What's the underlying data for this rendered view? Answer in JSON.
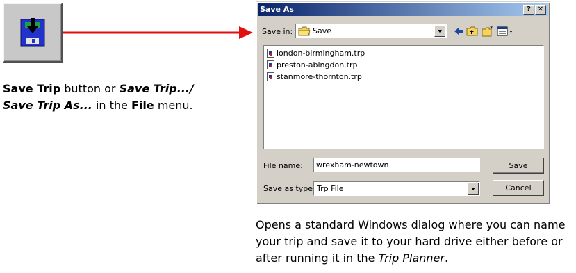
{
  "left_caption": {
    "bold1": "Save Trip",
    "text1": " button or ",
    "bi1": "Save Trip.../",
    "bi2": "Save Trip As...",
    "text2": " in the ",
    "bold2": "File",
    "text3": " menu."
  },
  "dialog": {
    "title": "Save As",
    "help_label": "?",
    "close_label": "✕",
    "save_in_label": "Save in:",
    "save_in_value": "Save",
    "files": [
      "london-birmingham.trp",
      "preston-abingdon.trp",
      "stanmore-thornton.trp"
    ],
    "file_name_label": "File name:",
    "file_name_value": "wrexham-newtown",
    "save_type_label": "Save as type:",
    "save_type_value": "Trp File",
    "save_button": "Save",
    "cancel_button": "Cancel"
  },
  "right_caption": {
    "text1": "Opens a standard Windows dialog where you can name your trip and save it to your hard drive either before or after running it in the ",
    "italic": "Trip Planner",
    "text2": "."
  },
  "icons": {
    "toolbar_button": "save-trip-disk-icon",
    "arrow": "red-arrow",
    "save_in_folder": "folder-icon"
  },
  "colors": {
    "arrow": "#e01010",
    "title_bar_start": "#0a246a",
    "title_bar_end": "#a6caf0",
    "dialog_face": "#d4d0c8"
  }
}
